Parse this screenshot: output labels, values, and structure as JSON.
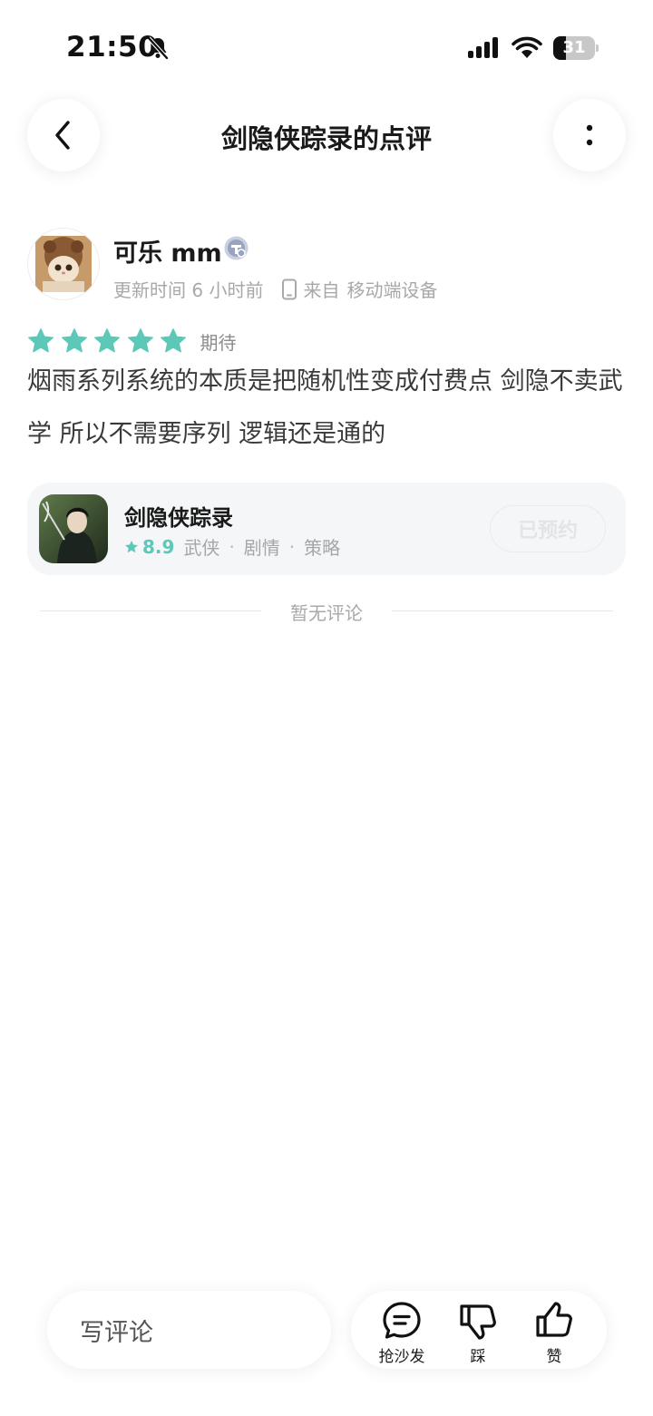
{
  "status_bar": {
    "time": "21:50",
    "battery_level": "31",
    "battery_fraction": 0.31
  },
  "header": {
    "title": "剑隐侠踪录的点评"
  },
  "review": {
    "author_name": "可乐 mm",
    "updated": "更新时间 6 小时前",
    "device_prefix": "来自",
    "device": "移动端设备",
    "rating_stars": 5,
    "rating_label": "期待",
    "body": "烟雨系列系统的本质是把随机性变成付费点 剑隐不卖武学 所以不需要序列 逻辑还是通的"
  },
  "game_card": {
    "name": "剑隐侠踪录",
    "score": "8.9",
    "tags": [
      "武侠",
      "剧情",
      "策略"
    ],
    "reserve_label": "已预约"
  },
  "comments": {
    "empty_text": "暂无评论"
  },
  "bottom_bar": {
    "comment_placeholder": "写评论",
    "actions": [
      {
        "icon": "comment-icon",
        "label": "抢沙发"
      },
      {
        "icon": "thumbs-down-icon",
        "label": "踩"
      },
      {
        "icon": "thumbs-up-icon",
        "label": "赞"
      }
    ]
  },
  "colors": {
    "accent": "#5bc8b8",
    "text": "#1a1a1a",
    "muted": "#a8a8a8",
    "card_bg": "#f4f6f8"
  }
}
